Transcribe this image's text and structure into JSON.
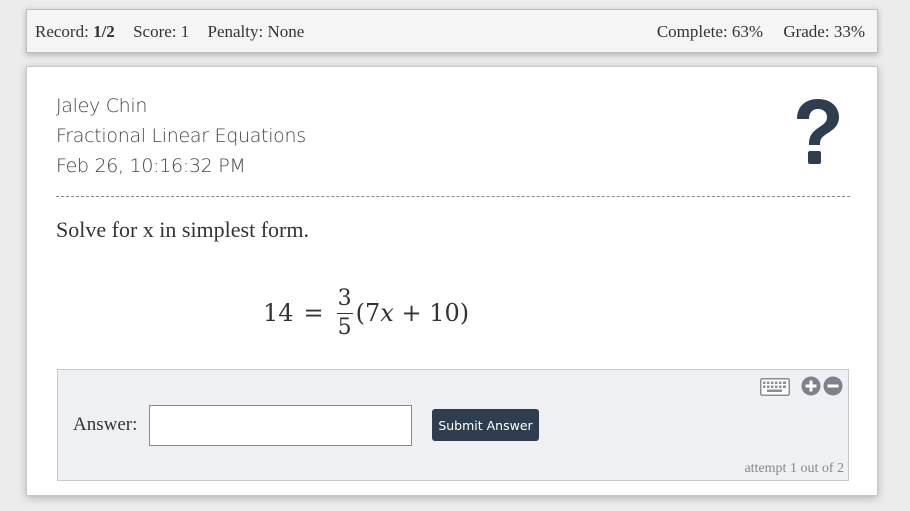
{
  "topbar": {
    "record_label": "Record:",
    "record_value": "1/2",
    "score": "Score: 1",
    "penalty": "Penalty: None",
    "complete": "Complete: 63%",
    "grade": "Grade: 33%"
  },
  "header": {
    "student_name": "Jaley Chin",
    "topic": "Fractional Linear Equations",
    "timestamp": "Feb 26, 10:16:32 PM",
    "help_icon": "question-mark-icon"
  },
  "problem": {
    "prompt": "Solve for x in simplest form.",
    "equation": {
      "lhs": "14",
      "sign": "=",
      "fraction_numerator": "3",
      "fraction_denominator": "5",
      "rhs_open": "(7",
      "rhs_var": "x",
      "rhs_rest": " + 10)"
    }
  },
  "answer": {
    "label": "Answer:",
    "value": "",
    "placeholder": "",
    "submit_label": "Submit Answer",
    "attempt_text": "attempt 1 out of 2",
    "icons": [
      "keyboard-icon",
      "zoom-in-icon",
      "zoom-out-icon"
    ]
  },
  "colors": {
    "button_bg": "#2f3e4f",
    "icon_color": "#2f3e4f",
    "answer_panel_bg": "#eef0f3"
  }
}
